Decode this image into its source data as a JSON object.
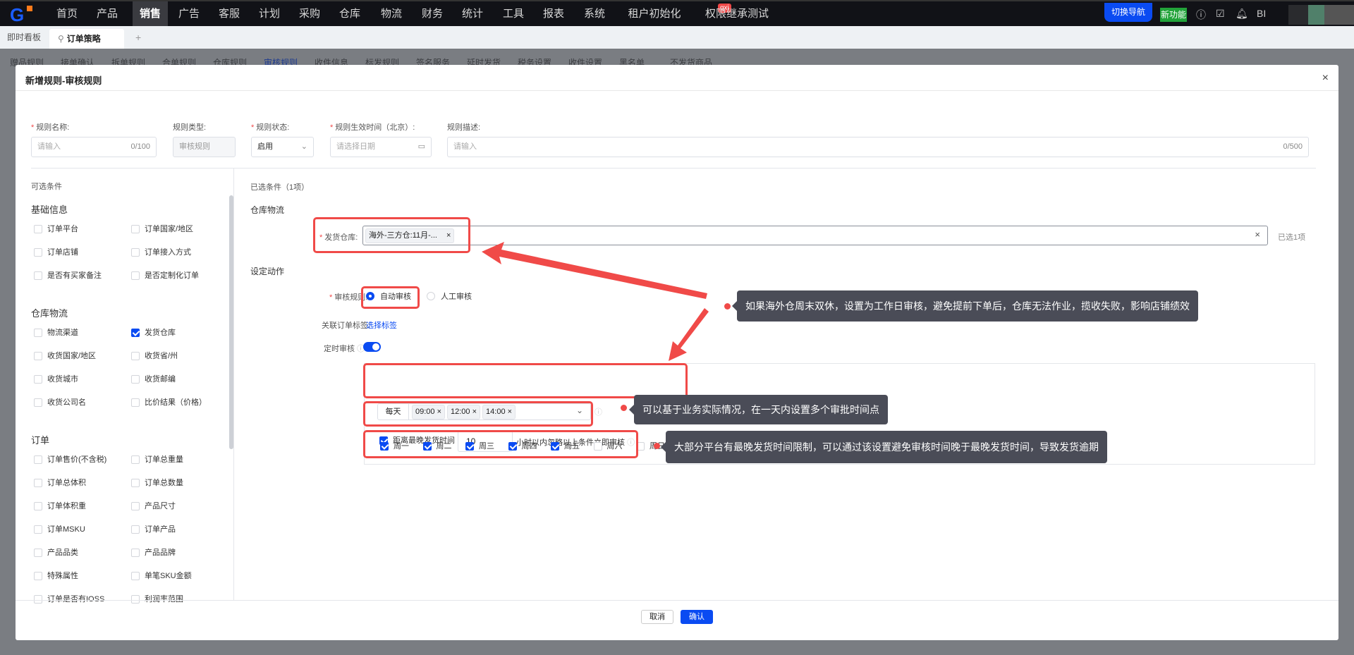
{
  "topnav": {
    "logo": "G",
    "items": [
      "首页",
      "产品",
      "销售",
      "广告",
      "客服",
      "计划",
      "采购",
      "仓库",
      "物流",
      "财务",
      "统计",
      "工具",
      "报表",
      "系统",
      "租户初始化",
      "权限继承测试"
    ],
    "active_index": 2,
    "badge": "qxj",
    "switch_nav": "切换导航",
    "new_feature": "新功能",
    "bi": "BI"
  },
  "tabs": {
    "dashboard": "即时看板",
    "current": "订单策略",
    "add": "+"
  },
  "subnav": {
    "items": [
      "赠品规则",
      "接单确认",
      "拆单规则",
      "合单规则",
      "仓库规则",
      "审核规则",
      "收件信息",
      "标发规则",
      "签名服务",
      "延时发货",
      "税务设置",
      "收件设置",
      "黑名单",
      "不发货商品"
    ],
    "active_index": 5
  },
  "modal": {
    "title": "新增规则-审核规则",
    "close": "×",
    "form": {
      "name_label": "规则名称:",
      "name_placeholder": "请输入",
      "name_count": "0/100",
      "type_label": "规则类型:",
      "type_value": "审核规则",
      "status_label": "规则状态:",
      "status_value": "启用",
      "time_label": "规则生效时间（北京）:",
      "time_placeholder": "请选择日期",
      "desc_label": "规则描述:",
      "desc_placeholder": "请输入",
      "desc_count": "0/500"
    },
    "left": {
      "title": "可选条件",
      "groups": [
        {
          "name": "基础信息",
          "items": [
            {
              "label": "订单平台",
              "checked": false
            },
            {
              "label": "订单国家/地区",
              "checked": false
            },
            {
              "label": "订单店铺",
              "checked": false
            },
            {
              "label": "订单接入方式",
              "checked": false
            },
            {
              "label": "是否有买家备注",
              "checked": false
            },
            {
              "label": "是否定制化订单",
              "checked": false
            }
          ]
        },
        {
          "name": "仓库物流",
          "items": [
            {
              "label": "物流渠道",
              "checked": false
            },
            {
              "label": "发货仓库",
              "checked": true
            },
            {
              "label": "收货国家/地区",
              "checked": false
            },
            {
              "label": "收货省/州",
              "checked": false
            },
            {
              "label": "收货城市",
              "checked": false
            },
            {
              "label": "收货邮编",
              "checked": false
            },
            {
              "label": "收货公司名",
              "checked": false
            },
            {
              "label": "比价结果（价格）",
              "checked": false
            }
          ]
        },
        {
          "name": "订单",
          "items": [
            {
              "label": "订单售价(不含税)",
              "checked": false
            },
            {
              "label": "订单总重量",
              "checked": false
            },
            {
              "label": "订单总体积",
              "checked": false
            },
            {
              "label": "订单总数量",
              "checked": false
            },
            {
              "label": "订单体积重",
              "checked": false
            },
            {
              "label": "产品尺寸",
              "checked": false
            },
            {
              "label": "订单MSKU",
              "checked": false
            },
            {
              "label": "订单产品",
              "checked": false
            },
            {
              "label": "产品品类",
              "checked": false
            },
            {
              "label": "产品品牌",
              "checked": false
            },
            {
              "label": "特殊属性",
              "checked": false
            },
            {
              "label": "单笔SKU金额",
              "checked": false
            },
            {
              "label": "订单是否有IOSS",
              "checked": false
            },
            {
              "label": "利润率范围",
              "checked": false
            }
          ]
        }
      ]
    },
    "right": {
      "title": "已选条件（1项）",
      "section1": "仓库物流",
      "warehouse_label": "发货仓库:",
      "warehouse_tag": "海外-三方仓:11月-...",
      "selected_count": "已选1项",
      "section2": "设定动作",
      "audit_label": "审核规则:",
      "audit_options": [
        {
          "label": "自动审核",
          "selected": true
        },
        {
          "label": "人工审核",
          "selected": false
        }
      ],
      "tag_label": "关联订单标签:",
      "tag_link": "选择标签",
      "timer_label": "定时审核",
      "timer_on": true,
      "weekdays": [
        {
          "label": "周一",
          "checked": true
        },
        {
          "label": "周二",
          "checked": true
        },
        {
          "label": "周三",
          "checked": true
        },
        {
          "label": "周四",
          "checked": true
        },
        {
          "label": "周五",
          "checked": true
        },
        {
          "label": "周六",
          "checked": false
        },
        {
          "label": "周日",
          "checked": false
        }
      ],
      "freq": "每天",
      "times": [
        "09:00",
        "12:00",
        "14:00"
      ],
      "latest_checked": true,
      "latest_label": "距离最晚发货时间",
      "latest_value": "10",
      "latest_suffix": "小时以内忽略以上条件立即审核"
    },
    "footer": {
      "cancel": "取消",
      "confirm": "确认"
    }
  },
  "annotations": {
    "tip1": "如果海外仓周末双休，设置为工作日审核，避免提前下单后，仓库无法作业，揽收失败，影响店铺绩效",
    "tip2": "可以基于业务实际情况，在一天内设置多个审批时间点",
    "tip3": "大部分平台有最晚发货时间限制，可以通过该设置避免审核时间晚于最晚发货时间，导致发货逾期"
  },
  "colors": {
    "accent": "#0a4bf2",
    "annotation_red": "#f04a48",
    "tooltip": "#4a4c57",
    "new_feature": "#22a33a"
  }
}
